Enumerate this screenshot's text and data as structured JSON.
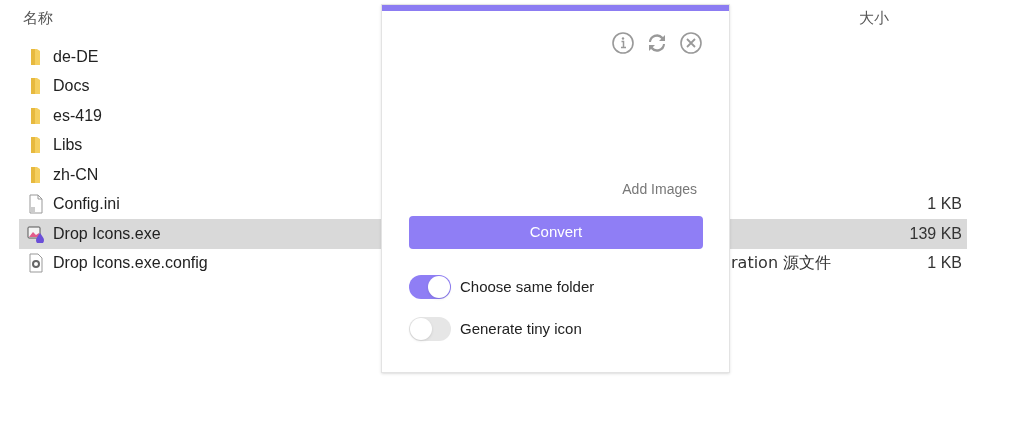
{
  "columns": {
    "name": "名称",
    "size": "大小"
  },
  "files": [
    {
      "name": "de-DE",
      "kind": "folder",
      "selected": false
    },
    {
      "name": "Docs",
      "kind": "folder",
      "selected": false
    },
    {
      "name": "es-419",
      "kind": "folder",
      "selected": false
    },
    {
      "name": "Libs",
      "kind": "folder",
      "selected": false
    },
    {
      "name": "zh-CN",
      "kind": "folder",
      "selected": false
    },
    {
      "name": "Config.ini",
      "kind": "ini",
      "selected": false,
      "size": "1 KB"
    },
    {
      "name": "Drop Icons.exe",
      "kind": "exe",
      "selected": true,
      "size": "139 KB"
    },
    {
      "name": "Drop Icons.exe.config",
      "kind": "config",
      "selected": false,
      "type": "ration 源文件",
      "size": "1 KB"
    }
  ],
  "popup": {
    "drop_hint": "Add Images",
    "convert": "Convert",
    "toggles": [
      {
        "label": "Choose same folder",
        "on": true
      },
      {
        "label": "Generate tiny icon",
        "on": false
      }
    ]
  }
}
